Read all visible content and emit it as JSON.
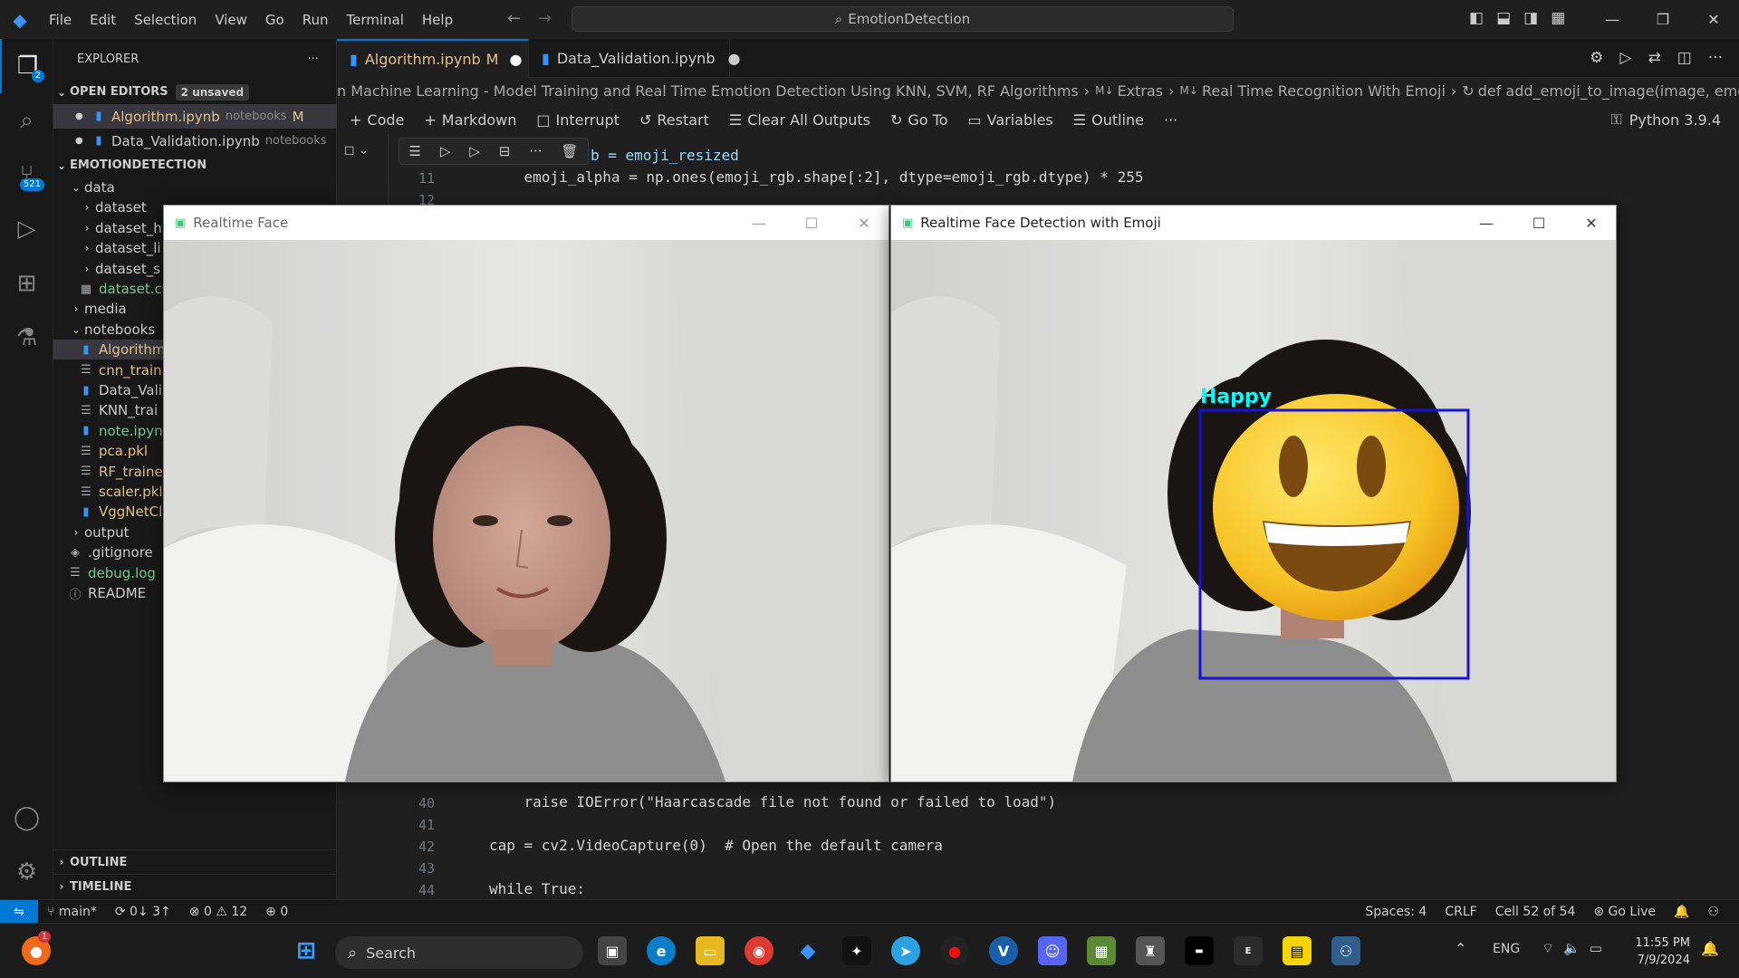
{
  "menu": [
    "File",
    "Edit",
    "Selection",
    "View",
    "Go",
    "Run",
    "Terminal",
    "Help"
  ],
  "search_text": "EmotionDetection",
  "activity_badges": {
    "explorer": "2",
    "scm": "521"
  },
  "explorer": {
    "title": "EXPLORER",
    "open_editors_label": "OPEN EDITORS",
    "unsaved_badge": "2 unsaved",
    "open_editors": [
      {
        "name": "Algorithm.ipynb",
        "path": "notebooks",
        "flag": "M"
      },
      {
        "name": "Data_Validation.ipynb",
        "path": "notebooks",
        "flag": ""
      }
    ],
    "project_label": "EMOTIONDETECTION",
    "tree": [
      {
        "name": "data",
        "type": "folder-open",
        "depth": 1
      },
      {
        "name": "dataset",
        "type": "folder",
        "depth": 2
      },
      {
        "name": "dataset_h",
        "type": "folder",
        "depth": 2
      },
      {
        "name": "dataset_li",
        "type": "folder",
        "depth": 2
      },
      {
        "name": "dataset_s",
        "type": "folder",
        "depth": 2
      },
      {
        "name": "dataset.cs",
        "type": "csv",
        "depth": 2
      },
      {
        "name": "media",
        "type": "folder",
        "depth": 1
      },
      {
        "name": "notebooks",
        "type": "folder-open",
        "depth": 1
      },
      {
        "name": "Algorithm",
        "type": "nb-mod",
        "depth": 2
      },
      {
        "name": "cnn_train",
        "type": "file-mod",
        "depth": 2
      },
      {
        "name": "Data_Vali",
        "type": "nb",
        "depth": 2
      },
      {
        "name": "KNN_trai",
        "type": "file",
        "depth": 2
      },
      {
        "name": "note.ipyn",
        "type": "nb-new",
        "depth": 2
      },
      {
        "name": "pca.pkl",
        "type": "file-mod",
        "depth": 2
      },
      {
        "name": "RF_trained",
        "type": "file-mod",
        "depth": 2
      },
      {
        "name": "scaler.pkl",
        "type": "file-mod",
        "depth": 2
      },
      {
        "name": "VggNetCl",
        "type": "nb-mod",
        "depth": 2
      },
      {
        "name": "output",
        "type": "folder",
        "depth": 1
      },
      {
        "name": ".gitignore",
        "type": "git",
        "depth": 1
      },
      {
        "name": "debug.log",
        "type": "file-new",
        "depth": 1
      },
      {
        "name": "README",
        "type": "info",
        "depth": 1
      }
    ],
    "outline_label": "OUTLINE",
    "timeline_label": "TIMELINE"
  },
  "tabs": [
    {
      "label": "Algorithm.ipynb",
      "flag": "M"
    },
    {
      "label": "Data_Validation.ipynb",
      "flag": ""
    }
  ],
  "breadcrumb": [
    "n Machine Learning - Model Training and Real Time Emotion Detection Using KNN, SVM, RF Algorithms",
    "Extras",
    "Real Time Recognition With Emoji",
    "def add_emoji_to_image(image, emoji_img, x, y, w, h):"
  ],
  "toolbar": [
    "Code",
    "Markdown",
    "Interrupt",
    "Restart",
    "Clear All Outputs",
    "Go To",
    "Variables",
    "Outline"
  ],
  "kernel": "Python 3.9.4",
  "code_top": [
    {
      "ln": "11",
      "text": "    emoji_alpha = np.ones(emoji_rgb.shape[:2], dtype=emoji_rgb.dtype) * 255"
    },
    {
      "ln": "12",
      "text": ""
    }
  ],
  "code_partial": "b = emoji_resized",
  "code_bottom": [
    {
      "ln": "40",
      "text": "    raise IOError(\"Haarcascade file not found or failed to load\")"
    },
    {
      "ln": "41",
      "text": ""
    },
    {
      "ln": "42",
      "text": "cap = cv2.VideoCapture(0)  # Open the default camera"
    },
    {
      "ln": "43",
      "text": ""
    },
    {
      "ln": "44",
      "text": "while True:"
    }
  ],
  "windows": {
    "left_title": "Realtime Face",
    "right_title": "Realtime Face Detection with Emoji",
    "emotion_label": "Happy"
  },
  "status": {
    "branch": "main*",
    "sync": "0↓ 3↑",
    "errors": "0",
    "warnings": "12",
    "ports": "0",
    "spaces": "Spaces: 4",
    "eol": "CRLF",
    "cell": "Cell 52 of 54",
    "golive": "Go Live"
  },
  "taskbar": {
    "search": "Search",
    "lang": "ENG",
    "time": "11:55 PM",
    "date": "7/9/2024",
    "notif_badge": "1"
  },
  "colors": {
    "accent": "#0078d4",
    "modified": "#e2c08d",
    "detect_box": "#1414d8",
    "label": "#00ffff"
  }
}
